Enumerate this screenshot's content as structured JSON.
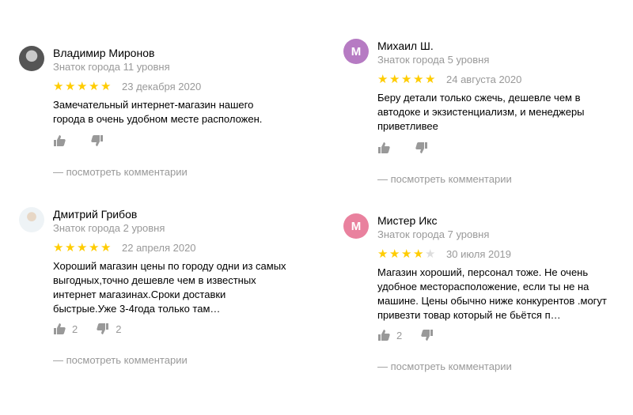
{
  "reviews": [
    {
      "name": "Владимир Миронов",
      "level": "Знаток города 11 уровня",
      "rating": 5,
      "date": "23 декабря 2020",
      "text": "Замечательный интернет-магазин нашего города в очень удобном месте расположен.",
      "likes": "",
      "dislikes": "",
      "comments": "— посмотреть комментарии",
      "avatar": "photo"
    },
    {
      "name": "Михаил Ш.",
      "level": "Знаток города 5 уровня",
      "rating": 5,
      "date": "24 августа 2020",
      "text": "Беру детали только сжечь, дешевле чем в автодоке и экзистенциализм, и менеджеры приветливее",
      "likes": "",
      "dislikes": "",
      "comments": "— посмотреть комментарии",
      "avatar_letter": "М",
      "avatar_color": "#b67bc3"
    },
    {
      "name": "Дмитрий Грибов",
      "level": "Знаток города 2 уровня",
      "rating": 5,
      "date": "22 апреля 2020",
      "text": "Хороший магазин цены по городу одни из самых выгодных,точно дешевле чем в известных интернет магазинах.Сроки доставки быстрые.Уже 3-4года только там…",
      "likes": "2",
      "dislikes": "2",
      "comments": "— посмотреть комментарии",
      "avatar": "photo"
    },
    {
      "name": "Мистер Икс",
      "level": "Знаток города 7 уровня",
      "rating": 4,
      "date": "30 июля 2019",
      "text": "Магазин хороший, персонал тоже. Не очень удобное месторасположение, если ты не на машине. Цены обычно ниже конкурентов .могут привезти товар который не бьётся п…",
      "likes": "2",
      "dislikes": "",
      "comments": "— посмотреть комментарии",
      "avatar_letter": "М",
      "avatar_color": "#e9819e"
    }
  ],
  "colors": {
    "star": "#ffcc00",
    "star_off": "#dddddd",
    "muted": "#999999"
  },
  "icons": {
    "like": "thumb-up-icon",
    "dislike": "thumb-down-icon"
  }
}
